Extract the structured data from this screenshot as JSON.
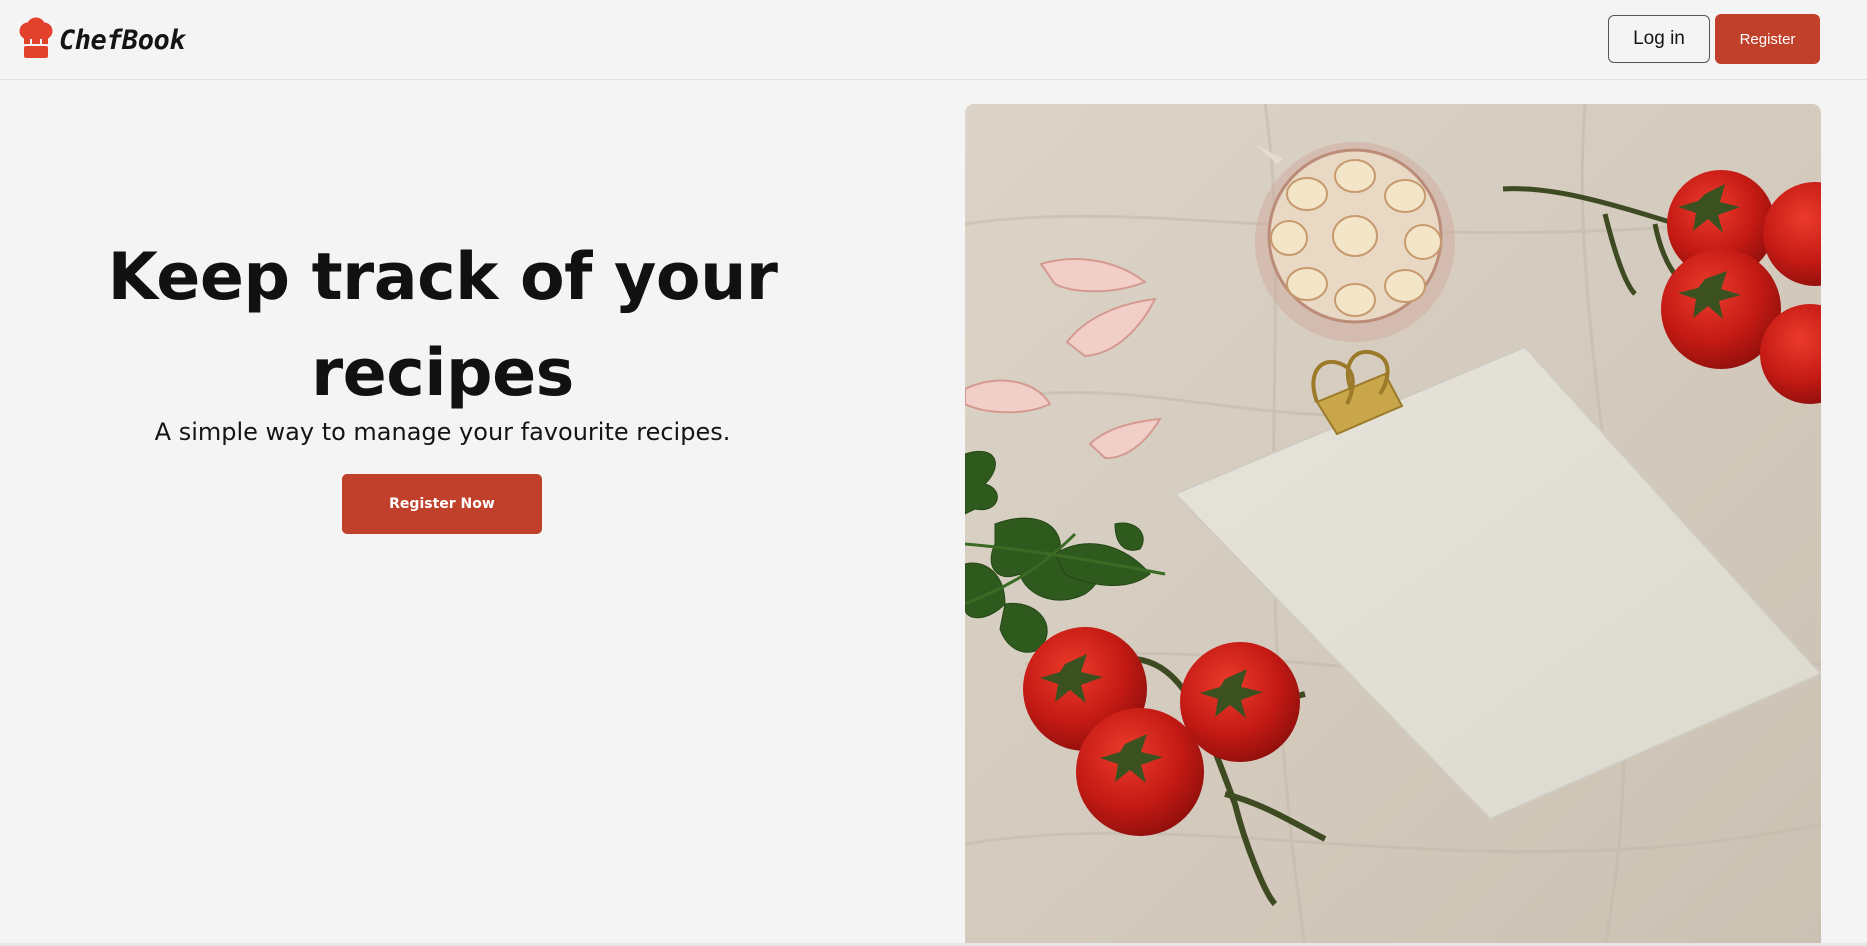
{
  "brand": {
    "name": "ChefBook",
    "logo_icon": "chef-hat-icon",
    "accent_color": "#c0402b"
  },
  "header": {
    "login_label": "Log in",
    "register_label": "Register"
  },
  "hero": {
    "title_line1": "Keep track of your",
    "title_line2": "recipes",
    "subtitle": "A simple way to manage your favourite recipes.",
    "cta_label": "Register Now"
  },
  "photo": {
    "subject": "stock-photo"
  }
}
